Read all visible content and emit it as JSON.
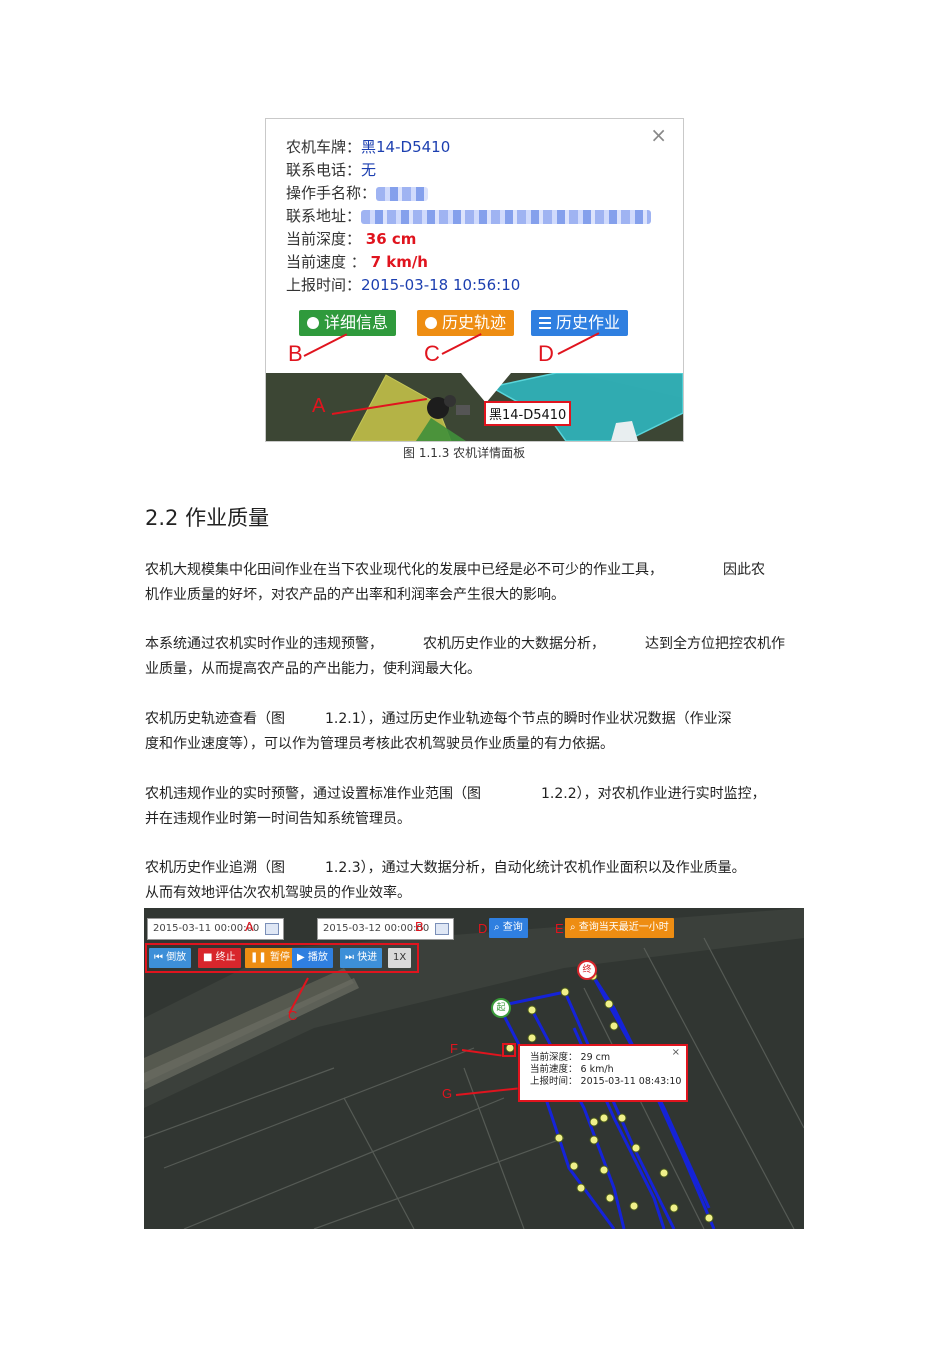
{
  "figure1": {
    "close_glyph": "×",
    "fields": [
      {
        "label": "农机车牌：",
        "value": "黑14-D5410",
        "style": "blue"
      },
      {
        "label": "联系电话：",
        "value": "无",
        "style": "blue"
      },
      {
        "label": "操作手名称：",
        "value": "",
        "style": "blur"
      },
      {
        "label": "联系地址：",
        "value": "",
        "style": "blur"
      },
      {
        "label": "当前深度：",
        "value": "36 cm",
        "style": "red"
      },
      {
        "label": "当前速度 ：",
        "value": "7 km/h",
        "style": "red"
      },
      {
        "label": "上报时间：",
        "value": "2015-03-18 10:56:10",
        "style": "blue"
      }
    ],
    "buttons": [
      {
        "label": "详细信息",
        "icon": "info-icon",
        "color": "#2f9a3c"
      },
      {
        "label": "历史轨迹",
        "icon": "clock-icon",
        "color": "#ee8d12"
      },
      {
        "label": "历史作业",
        "icon": "list-icon",
        "color": "#2f7fe0"
      }
    ],
    "markers": [
      "A",
      "B",
      "C",
      "D"
    ],
    "map_plate": "黑14-D5410",
    "caption": "图 1.1.3  农机详情面板"
  },
  "section": {
    "title": "2.2 作业质量"
  },
  "paragraphs": [
    [
      "农机大规模集中化田间作业在当下农业现代化的发展中已经是必不可少的作业工具，",
      "因此农",
      "机作业质量的好坏，对农产品的产出率和利润率会产生很大的影响。"
    ],
    [
      "本系统通过农机实时作业的违规预警，",
      "农机历史作业的大数据分析，",
      "达到全方位把控农机作",
      "业质量，从而提高农产品的产出能力，使利润最大化。"
    ],
    [
      "农机历史轨迹查看（图",
      "1.2.1），通过历史作业轨迹每个节点的瞬时作业状况数据（作业深",
      "度和作业速度等），可以作为管理员考核此农机驾驶员作业质量的有力依据。"
    ],
    [
      "农机违规作业的实时预警，通过设置标准作业范围（图",
      "1.2.2），对农机作业进行实时监控，",
      "并在违规作业时第一时间告知系统管理员。"
    ],
    [
      "农机历史作业追溯（图",
      "1.2.3），通过大数据分析，自动化统计农机作业面积以及作业质量。",
      "从而有效地评估次农机驾驶员的作业效率。"
    ]
  ],
  "figure2": {
    "date_start": "2015-03-11 00:00:00",
    "date_end": "2015-03-12 00:00:00",
    "query_button": "查询",
    "query_recent_button": "查询当天最近一小时",
    "toolbar": [
      "倒放",
      "终止",
      "暂停",
      "播放",
      "快进",
      "1X"
    ],
    "toolbar_colors": [
      "#3d8fd8",
      "#d8262c",
      "#ee8d12",
      "#2f7fe0",
      "#3d8fd8",
      "#d9d9d9"
    ],
    "start_label": "起",
    "end_label": "终",
    "markers": [
      "A",
      "B",
      "C",
      "D",
      "E",
      "F",
      "G"
    ],
    "popup": {
      "depth_label": "当前深度：",
      "depth_value": "29 cm",
      "speed_label": "当前速度：",
      "speed_value": "6 km/h",
      "time_label": "上报时间：",
      "time_value": "2015-03-11 08:43:10",
      "close_glyph": "×"
    }
  }
}
